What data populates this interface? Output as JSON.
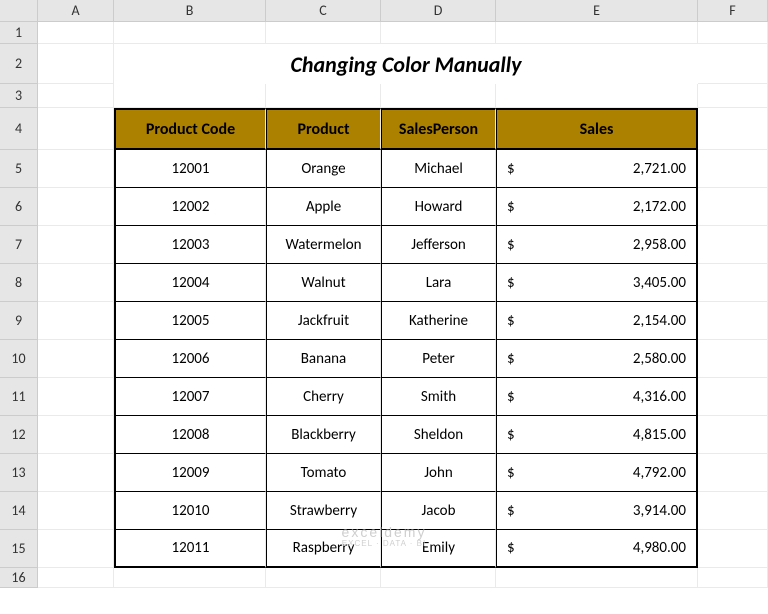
{
  "columns": [
    "A",
    "B",
    "C",
    "D",
    "E",
    "F"
  ],
  "rows": [
    "1",
    "2",
    "3",
    "4",
    "5",
    "6",
    "7",
    "8",
    "9",
    "10",
    "11",
    "12",
    "13",
    "14",
    "15",
    "16"
  ],
  "title": "Changing Color Manually",
  "headers": {
    "code": "Product Code",
    "product": "Product",
    "salesperson": "SalesPerson",
    "sales": "Sales"
  },
  "currency": "$",
  "table": [
    {
      "code": "12001",
      "product": "Orange",
      "salesperson": "Michael",
      "sales": "2,721.00"
    },
    {
      "code": "12002",
      "product": "Apple",
      "salesperson": "Howard",
      "sales": "2,172.00"
    },
    {
      "code": "12003",
      "product": "Watermelon",
      "salesperson": "Jefferson",
      "sales": "2,958.00"
    },
    {
      "code": "12004",
      "product": "Walnut",
      "salesperson": "Lara",
      "sales": "3,405.00"
    },
    {
      "code": "12005",
      "product": "Jackfruit",
      "salesperson": "Katherine",
      "sales": "2,154.00"
    },
    {
      "code": "12006",
      "product": "Banana",
      "salesperson": "Peter",
      "sales": "2,580.00"
    },
    {
      "code": "12007",
      "product": "Cherry",
      "salesperson": "Smith",
      "sales": "4,316.00"
    },
    {
      "code": "12008",
      "product": "Blackberry",
      "salesperson": "Sheldon",
      "sales": "4,815.00"
    },
    {
      "code": "12009",
      "product": "Tomato",
      "salesperson": "John",
      "sales": "4,792.00"
    },
    {
      "code": "12010",
      "product": "Strawberry",
      "salesperson": "Jacob",
      "sales": "3,914.00"
    },
    {
      "code": "12011",
      "product": "Raspberry",
      "salesperson": "Emily",
      "sales": "4,980.00"
    }
  ],
  "watermark": {
    "main": "exceldemy",
    "sub": "EXCEL · DATA · BI"
  }
}
